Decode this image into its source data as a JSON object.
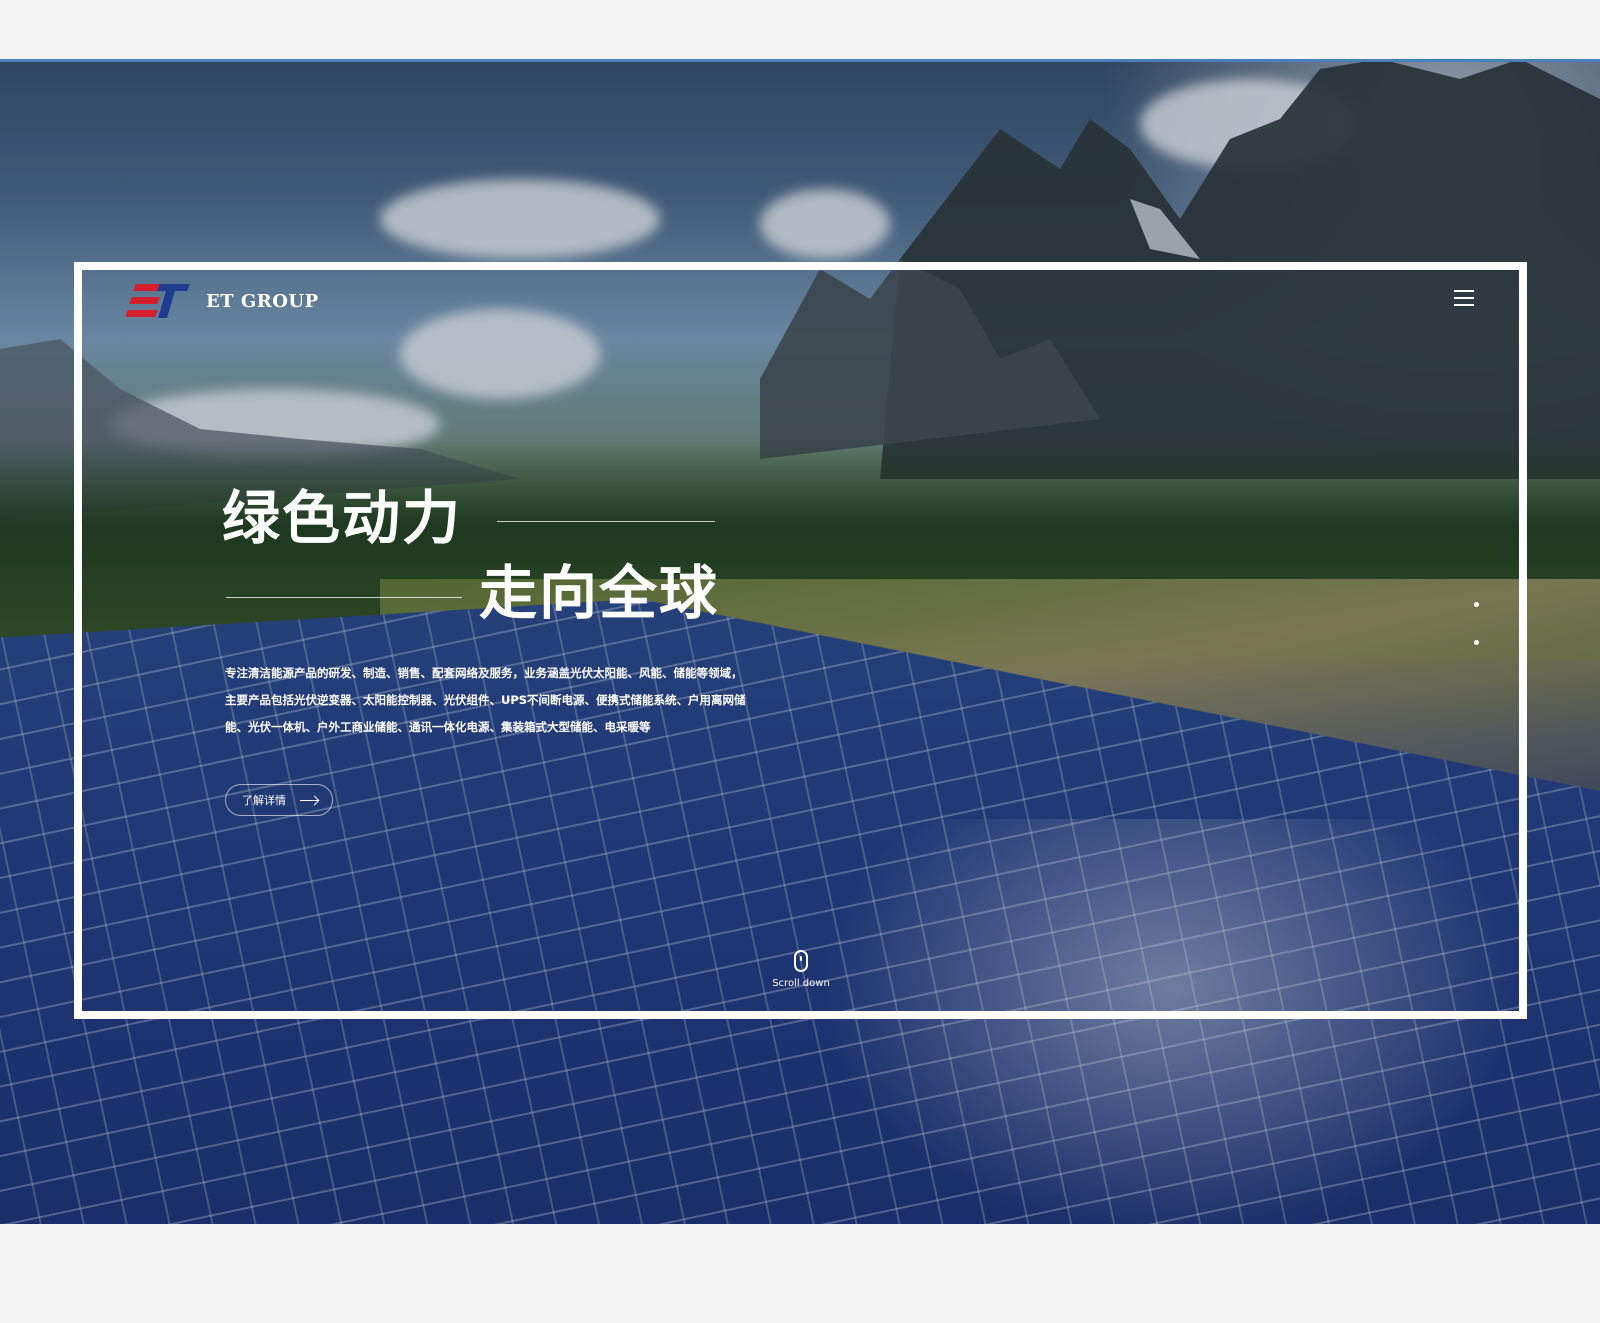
{
  "brand": {
    "name": "ET GROUP",
    "logo_mark": "ET"
  },
  "hero": {
    "headline_line1": "绿色动力",
    "headline_line2": "走向全球",
    "description": "专注清洁能源产品的研发、制造、销售、配套网络及服务，业务涵盖光伏太阳能、风能、储能等领域，主要产品包括光伏逆变器、太阳能控制器、光伏组件、UPS不间断电源、便携式储能系统、户用离网储能、光伏一体机、户外工商业储能、通讯一体化电源、集装箱式大型储能、电采暖等",
    "cta_label": "了解详情",
    "scroll_label": "Scroll down"
  },
  "nav": {
    "menu_icon": "hamburger-menu-icon"
  },
  "colors": {
    "logo_red": "#d21f2b",
    "logo_blue": "#1f3b8f",
    "frame": "#ffffff"
  }
}
